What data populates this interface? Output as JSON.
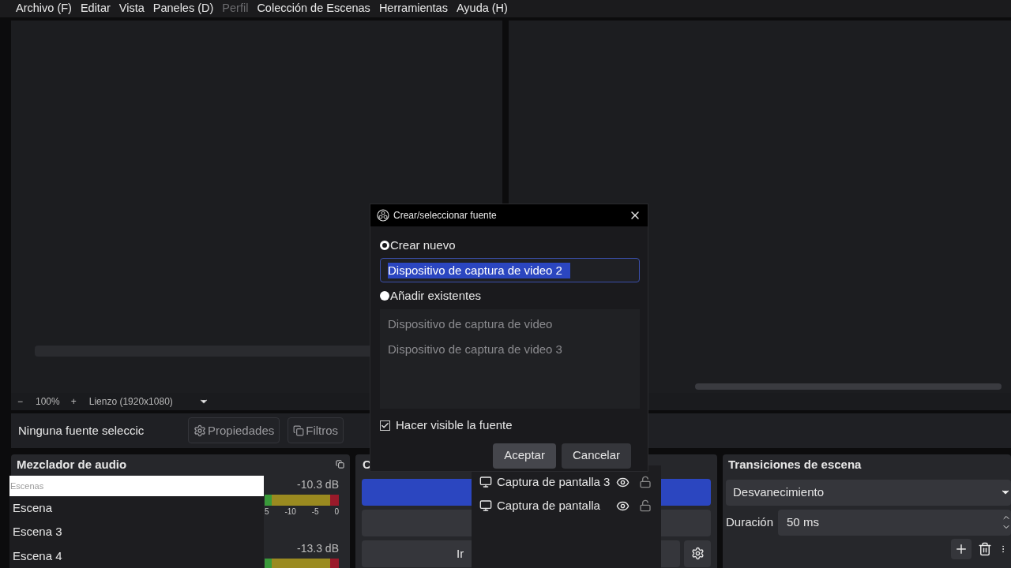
{
  "menu": [
    {
      "label": "Archivo (F)",
      "disabled": false
    },
    {
      "label": "Editar",
      "disabled": false
    },
    {
      "label": "Vista",
      "disabled": false
    },
    {
      "label": "Paneles (D)",
      "disabled": false
    },
    {
      "label": "Perfil",
      "disabled": true
    },
    {
      "label": "Colección de Escenas",
      "disabled": false
    },
    {
      "label": "Herramientas",
      "disabled": false
    },
    {
      "label": "Ayuda (H)",
      "disabled": false
    }
  ],
  "zoom_bar": {
    "zoom_out": "−",
    "zoom": "100%",
    "zoom_in": "+",
    "canvas": "Lienzo (1920x1080)"
  },
  "source_toolbar": {
    "status": "Ninguna fuente seleccic",
    "buttons": [
      "Propiedades",
      "Filtros"
    ]
  },
  "audio_mixer": {
    "title": "Mezclador de audio",
    "channels": [
      {
        "reading": "-10.3 dB"
      },
      {
        "reading": "-13.3 dB"
      }
    ],
    "scale": [
      "5",
      "-10",
      "-5",
      "0"
    ]
  },
  "scenes_popup": {
    "placeholder": "Escenas",
    "items": [
      "Escena",
      "Escena 3",
      "Escena 4"
    ]
  },
  "controls": {
    "title": "C",
    "buttons": [
      {
        "kind": "primary"
      },
      {
        "kind": "plain"
      },
      {
        "kind": "plain",
        "label": "Ir"
      }
    ]
  },
  "sources_popup": {
    "items": [
      {
        "label": "Captura de pantalla 3",
        "visible": true,
        "locked": false
      },
      {
        "label": "Captura de pantalla",
        "visible": true,
        "locked": false
      }
    ]
  },
  "transitions": {
    "title": "Transiciones de escena",
    "transition": "Desvanecimiento",
    "duration_label": "Duración",
    "duration": "50 ms"
  },
  "dialog": {
    "title": "Crear/seleccionar fuente",
    "options": [
      {
        "label": "Crear nuevo",
        "selected": true
      },
      {
        "label": "Añadir existentes",
        "selected": false
      }
    ],
    "name_value": "Dispositivo de captura de video 2",
    "existing": [
      "Dispositivo de captura de video",
      "Dispositivo de captura de video 3"
    ],
    "make_visible": {
      "label": "Hacer visible la fuente",
      "checked": true
    },
    "buttons": [
      "Aceptar",
      "Cancelar"
    ]
  }
}
